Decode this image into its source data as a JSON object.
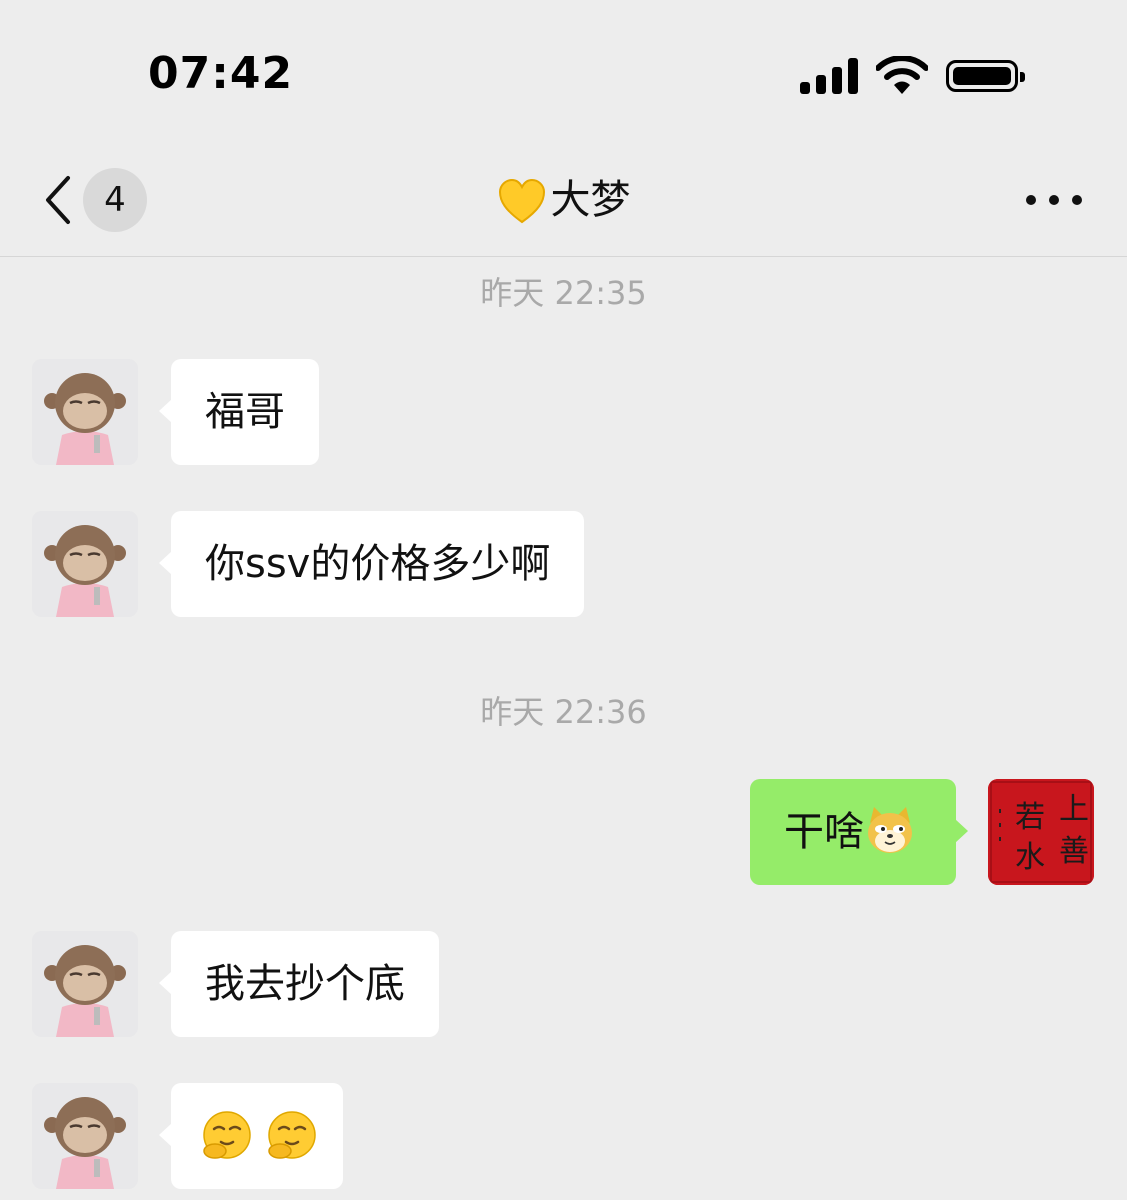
{
  "status_bar": {
    "time": "07:42"
  },
  "nav": {
    "unread_count": "4",
    "title": "大梦"
  },
  "messages": {
    "ts1": "昨天 22:35",
    "m1": "福哥",
    "m2": "你ssv的价格多少啊",
    "ts2": "昨天 22:36",
    "m3": "干啥",
    "m4": "我去抄个底"
  },
  "self_avatar": {
    "calligraphy": [
      "上",
      "善",
      "若",
      "水"
    ]
  },
  "icons": {
    "back": "chevron-left-icon",
    "title_emoji": "yellow-heart-icon",
    "more": "more-dots-icon",
    "doge": "doge-emoji",
    "smirk": "smirk-emoji"
  },
  "colors": {
    "background": "#ededed",
    "incoming_bubble": "#ffffff",
    "outgoing_bubble": "#95ec69",
    "timestamp": "#a9a9a9"
  }
}
